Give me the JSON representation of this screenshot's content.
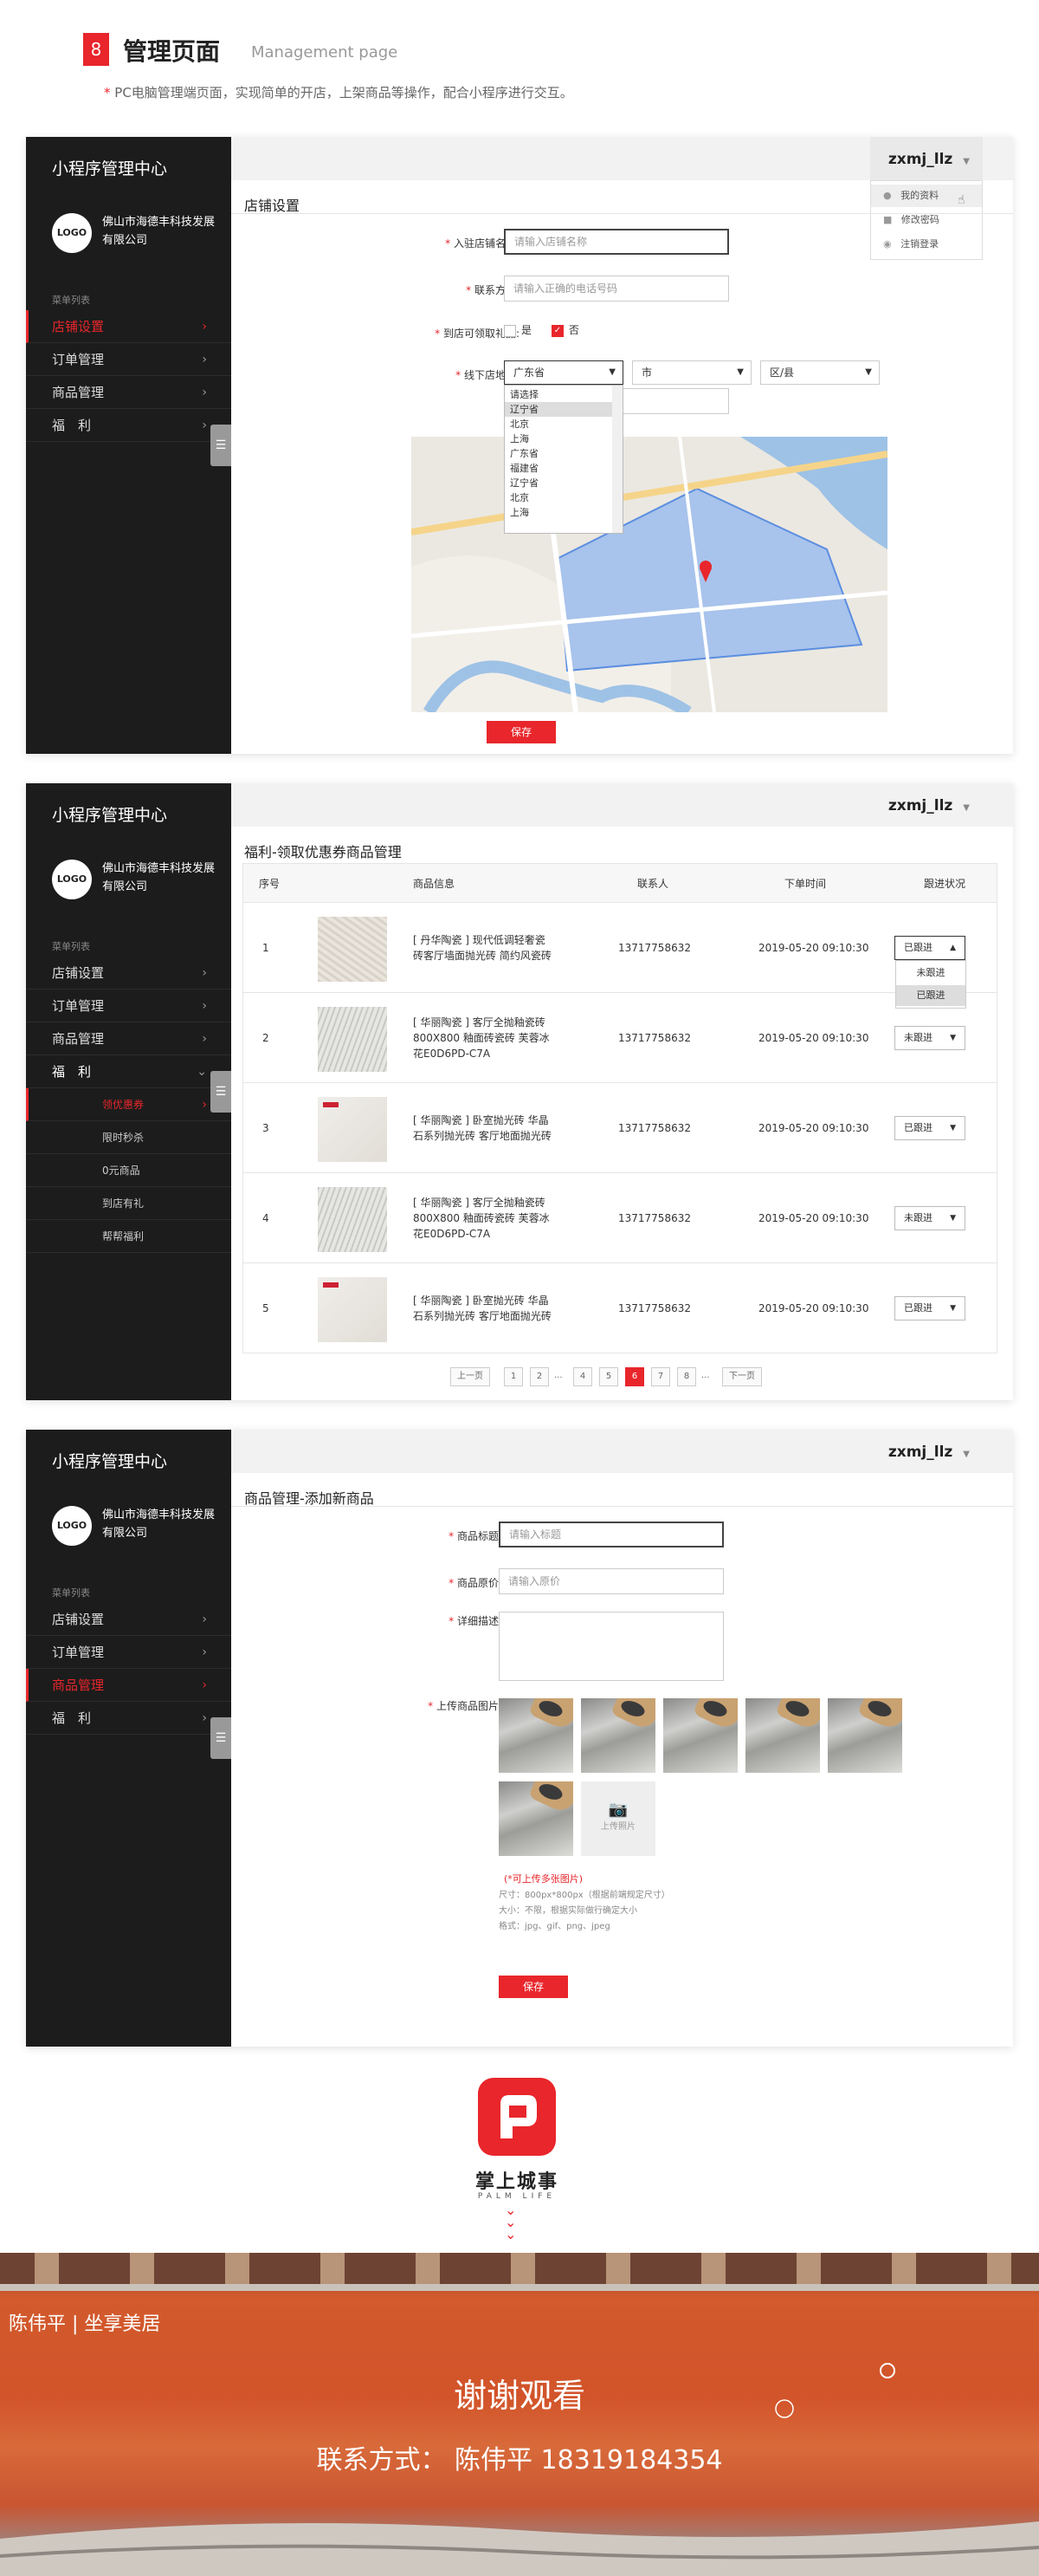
{
  "header": {
    "number": "8",
    "title_cn": "管理页面",
    "title_en": "Management page",
    "subtitle": "PC电脑管理端页面，实现简单的开店，上架商品等操作，配合小程序进行交互。"
  },
  "sidebar": {
    "title": "小程序管理中心",
    "logo": "LOGO",
    "company": "佛山市海德丰科技发展有限公司",
    "menu_label": "菜单列表"
  },
  "nav": {
    "store": "店铺设置",
    "orders": "订单管理",
    "goods": "商品管理",
    "welfare": "福　利",
    "toggle": "☰"
  },
  "welfare_sub": [
    "领优惠券",
    "限时秒杀",
    "0元商品",
    "到店有礼",
    "帮帮福利"
  ],
  "user": {
    "name": "zxmj_llz"
  },
  "user_menu": [
    "我的资料",
    "修改密码",
    "注销登录"
  ],
  "panel1": {
    "section": "店铺设置",
    "store_name_label": "入驻店铺名称:",
    "store_name_placeholder": "请输入店铺名称",
    "contact_label": "联系方式:",
    "contact_placeholder": "请输入正确的电话号码",
    "gift_label": "到店可领取礼品:",
    "gift_yes": "是",
    "gift_no": "否",
    "address_label": "线下店地址:",
    "province": "广东省",
    "city": "市",
    "district": "区/县",
    "province_options": [
      "请选择",
      "辽宁省",
      "北京",
      "上海",
      "广东省",
      "福建省",
      "辽宁省",
      "北京",
      "上海"
    ],
    "save": "保存"
  },
  "panel2": {
    "section": "福利-领取优惠券商品管理",
    "headers": [
      "序号",
      "商品信息",
      "联系人",
      "下单时间",
      "跟进状况"
    ],
    "rows": [
      {
        "no": "1",
        "info": "[ 丹华陶瓷 ] 现代低调轻奢瓷砖客厅墙面抛光砖 简约风瓷砖",
        "contact": "13717758632",
        "time": "2019-05-20  09:10:30",
        "status": "已跟进"
      },
      {
        "no": "2",
        "info": "[ 华丽陶瓷 ] 客厅全抛釉瓷砖800X800 釉面砖瓷砖 芙蓉冰花E0D6PD-C7A",
        "contact": "13717758632",
        "time": "2019-05-20  09:10:30",
        "status": "未跟进"
      },
      {
        "no": "3",
        "info": "[ 华丽陶瓷 ] 卧室抛光砖 华晶石系列抛光砖 客厅地面抛光砖",
        "contact": "13717758632",
        "time": "2019-05-20  09:10:30",
        "status": "已跟进"
      },
      {
        "no": "4",
        "info": "[ 华丽陶瓷 ] 客厅全抛釉瓷砖800X800 釉面砖瓷砖 芙蓉冰花E0D6PD-C7A",
        "contact": "13717758632",
        "time": "2019-05-20  09:10:30",
        "status": "未跟进"
      },
      {
        "no": "5",
        "info": "[ 华丽陶瓷 ] 卧室抛光砖 华晶石系列抛光砖 客厅地面抛光砖",
        "contact": "13717758632",
        "time": "2019-05-20  09:10:30",
        "status": "已跟进"
      }
    ],
    "status_options": [
      "未跟进",
      "已跟进"
    ],
    "pager": {
      "prev": "上一页",
      "pages": [
        "1",
        "2",
        "...",
        "4",
        "5",
        "6",
        "7",
        "8",
        "..."
      ],
      "current": "6",
      "next": "下一页"
    }
  },
  "panel3": {
    "section": "商品管理-添加新商品",
    "title_label": "商品标题:",
    "title_placeholder": "请输入标题",
    "price_label": "商品原价:",
    "price_placeholder": "请输入原价",
    "desc_label": "详细描述:",
    "images_label": "上传商品图片:",
    "upload_label": "上传照片",
    "note_red": "(*可上传多张图片)",
    "note_size": "尺寸：800px*800px（根据前端规定尺寸）",
    "note_filesize": "大小：不限，根据实际做行确定大小",
    "note_format": "格式：jpg、gif、png、jpeg",
    "save": "保存"
  },
  "brand": {
    "name": "掌上城事",
    "name_en": "PALM LIFE"
  },
  "footer": {
    "author": "陈伟平 | 坐享美居",
    "thanks": "谢谢观看",
    "contact": "联系方式：  陈伟平  18319184354"
  },
  "colors": {
    "accent": "#e8262b",
    "sidebar": "#1c1c1c"
  }
}
